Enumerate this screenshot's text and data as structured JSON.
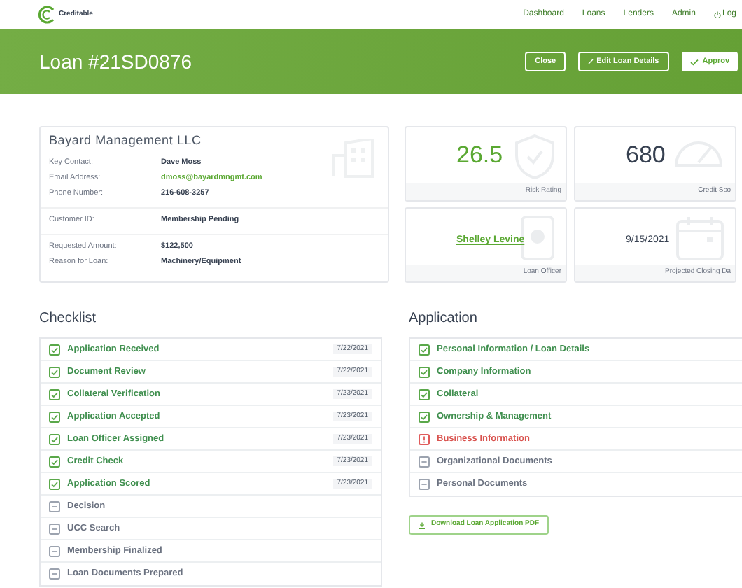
{
  "brand": {
    "name": "Creditable"
  },
  "nav": [
    {
      "label": "Dashboard",
      "kind": "link"
    },
    {
      "label": "Loans",
      "kind": "link"
    },
    {
      "label": "Lenders",
      "kind": "link"
    },
    {
      "label": "Admin",
      "kind": "link"
    },
    {
      "label": "Log",
      "kind": "logout"
    }
  ],
  "header": {
    "title": "Loan #21SD0876",
    "buttons": [
      {
        "label": "Close",
        "kind": "outline"
      },
      {
        "label": "Edit Loan Details",
        "kind": "edit"
      },
      {
        "label": "Approv",
        "kind": "approve"
      }
    ]
  },
  "company": {
    "name": "Bayard Management LLC",
    "groups": [
      [
        {
          "label": "Key Contact:",
          "value": "Dave Moss",
          "kind": "text"
        },
        {
          "label": "Email Address:",
          "value": "dmoss@bayardmngmt.com",
          "kind": "link"
        },
        {
          "label": "Phone Number:",
          "value": "216-608-3257",
          "kind": "text"
        }
      ],
      [
        {
          "label": "Customer ID:",
          "value": "Membership Pending",
          "kind": "text"
        }
      ],
      [
        {
          "label": "Requested Amount:",
          "value": "$122,500",
          "kind": "text"
        },
        {
          "label": "Reason for Loan:",
          "value": "Machinery/Equipment",
          "kind": "text"
        }
      ]
    ]
  },
  "stats": [
    {
      "value": "26.5",
      "label": "Risk Rating",
      "kind": "score"
    },
    {
      "value": "680",
      "label": "Credit Sco",
      "kind": "number"
    },
    {
      "value": "Shelley Levine",
      "label": "Loan Officer",
      "kind": "link"
    },
    {
      "value": "9/15/2021",
      "label": "Projected Closing Da",
      "kind": "date"
    }
  ],
  "checklist": {
    "title": "Checklist",
    "items": [
      {
        "label": "Application Received",
        "kind": "done",
        "date": "7/22/2021"
      },
      {
        "label": "Document Review",
        "kind": "done",
        "date": "7/22/2021"
      },
      {
        "label": "Collateral Verification",
        "kind": "done",
        "date": "7/23/2021"
      },
      {
        "label": "Application Accepted",
        "kind": "done",
        "date": "7/23/2021"
      },
      {
        "label": "Loan Officer Assigned",
        "kind": "done",
        "date": "7/23/2021"
      },
      {
        "label": "Credit Check",
        "kind": "done",
        "date": "7/23/2021"
      },
      {
        "label": "Application Scored",
        "kind": "done",
        "date": "7/23/2021"
      },
      {
        "label": "Decision",
        "kind": "pending"
      },
      {
        "label": "UCC Search",
        "kind": "pending"
      },
      {
        "label": "Membership Finalized",
        "kind": "pending"
      },
      {
        "label": "Loan Documents Prepared",
        "kind": "pending"
      }
    ]
  },
  "application": {
    "title": "Application",
    "items": [
      {
        "label": "Personal Information / Loan Details",
        "kind": "done"
      },
      {
        "label": "Company Information",
        "kind": "done"
      },
      {
        "label": "Collateral",
        "kind": "done"
      },
      {
        "label": "Ownership & Management",
        "kind": "done"
      },
      {
        "label": "Business Information",
        "kind": "error"
      },
      {
        "label": "Organizational Documents",
        "kind": "pending"
      },
      {
        "label": "Personal Documents",
        "kind": "pending"
      }
    ],
    "download": "Download Loan Application PDF"
  }
}
